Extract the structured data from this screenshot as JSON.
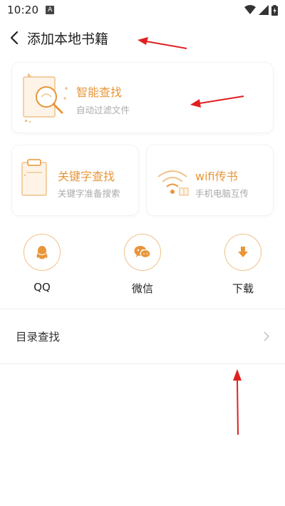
{
  "status_bar": {
    "time": "10:20",
    "notification_letter": "A"
  },
  "header": {
    "title": "添加本地书籍"
  },
  "cards": {
    "smart_search": {
      "title": "智能查找",
      "subtitle": "自动过滤文件"
    },
    "keyword_search": {
      "title": "关键字查找",
      "subtitle": "关键字准备搜索"
    },
    "wifi_transfer": {
      "title": "wifi传书",
      "subtitle": "手机电脑互传"
    }
  },
  "quick_buttons": {
    "qq": {
      "label": "QQ"
    },
    "wechat": {
      "label": "微信"
    },
    "download": {
      "label": "下载"
    }
  },
  "directory_search": {
    "label": "目录查找"
  },
  "colors": {
    "accent": "#e8963a",
    "accent_light": "#f0c18a",
    "annotation": "#e02020"
  }
}
